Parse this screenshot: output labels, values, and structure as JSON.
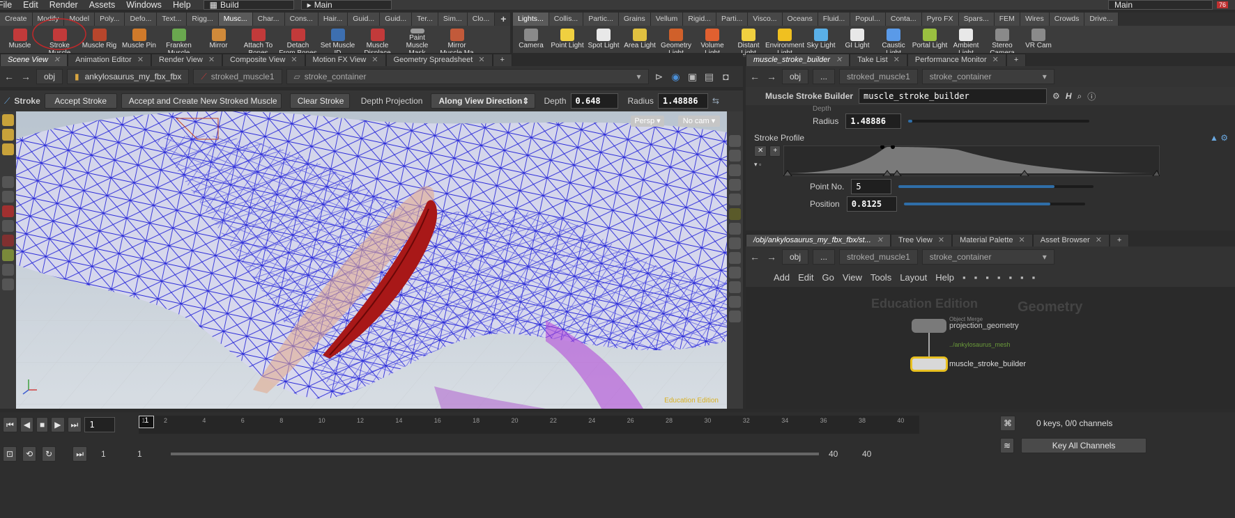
{
  "menu": [
    "File",
    "Edit",
    "Render",
    "Assets",
    "Windows",
    "Help"
  ],
  "desktop": {
    "build": "Build",
    "main": "Main"
  },
  "shelf_tabs_left": [
    "Create",
    "Modify",
    "Model",
    "Poly...",
    "Defo...",
    "Text...",
    "Rigg...",
    "Musc...",
    "Char...",
    "Cons...",
    "Hair...",
    "Guid...",
    "Guid...",
    "Ter...",
    "Sim...",
    "Clo..."
  ],
  "shelf_tabs_right": [
    "Lights...",
    "Collis...",
    "Partic...",
    "Grains",
    "Vellum",
    "Rigid...",
    "Parti...",
    "Visco...",
    "Oceans",
    "Fluid...",
    "Popul...",
    "Conta...",
    "Pyro FX",
    "Spars...",
    "FEM",
    "Wires",
    "Crowds",
    "Drive..."
  ],
  "tools_left": [
    {
      "label": "Muscle",
      "color": "#c23a3a"
    },
    {
      "label": "Stroke Muscle",
      "color": "#c23a3a"
    },
    {
      "label": "Muscle Rig",
      "color": "#b8462c"
    },
    {
      "label": "Muscle Pin",
      "color": "#d07a2a"
    },
    {
      "label": "Franken Muscle",
      "color": "#6aa84f"
    },
    {
      "label": "Mirror",
      "color": "#d08a3a"
    },
    {
      "label": "Attach To Bones",
      "color": "#c23a3a"
    },
    {
      "label": "Detach From Bones",
      "color": "#c23a3a"
    },
    {
      "label": "Set Muscle ID",
      "color": "#3d6fb0"
    },
    {
      "label": "Muscle Displace",
      "color": "#c23a3a"
    },
    {
      "label": "Paint Muscle Mask",
      "color": "#9a9a9a"
    },
    {
      "label": "Mirror Muscle Ma",
      "color": "#c25a3a"
    }
  ],
  "tools_right": [
    {
      "label": "Camera",
      "color": "#8a8a8a"
    },
    {
      "label": "Point Light",
      "color": "#f0d040"
    },
    {
      "label": "Spot Light",
      "color": "#e8e8e8"
    },
    {
      "label": "Area Light",
      "color": "#e0c040"
    },
    {
      "label": "Geometry Light",
      "color": "#d0602a"
    },
    {
      "label": "Volume Light",
      "color": "#e06030"
    },
    {
      "label": "Distant Light",
      "color": "#f0d040"
    },
    {
      "label": "Environment Light",
      "color": "#f0c020"
    },
    {
      "label": "Sky Light",
      "color": "#5ab0e8"
    },
    {
      "label": "GI Light",
      "color": "#e8e8e8"
    },
    {
      "label": "Caustic Light",
      "color": "#5a9ae8"
    },
    {
      "label": "Portal Light",
      "color": "#9ac040"
    },
    {
      "label": "Ambient Light",
      "color": "#e8e8e8"
    },
    {
      "label": "Stereo Camera",
      "color": "#8a8a8a"
    },
    {
      "label": "VR Cam",
      "color": "#8a8a8a"
    }
  ],
  "left_pane_tabs": [
    "Scene View",
    "Animation Editor",
    "Render View",
    "Composite View",
    "Motion FX View",
    "Geometry Spreadsheet"
  ],
  "left_path": {
    "root": "obj",
    "c1": "ankylosaurus_my_fbx_fbx",
    "c2": "stroked_muscle1",
    "c3": "stroke_container"
  },
  "stroke_toolbar": {
    "name": "Stroke",
    "accept": "Accept Stroke",
    "accept_create": "Accept and Create New Stroked Muscle",
    "clear": "Clear Stroke",
    "depth_projection_label": "Depth Projection",
    "depth_projection_value": "Along View Direction",
    "depth_label": "Depth",
    "depth_value": "0.648",
    "radius_label": "Radius",
    "radius_value": "1.48886"
  },
  "viewport": {
    "persp": "Persp",
    "cam": "No cam",
    "watermark": "Education Edition"
  },
  "right_top_tabs": [
    "muscle_stroke_builder",
    "Take List",
    "Performance Monitor"
  ],
  "right_path": {
    "root": "obj",
    "dots": "...",
    "c1": "stroked_muscle1",
    "c2": "stroke_container"
  },
  "params": {
    "node_type": "Muscle Stroke Builder",
    "node_name": "muscle_stroke_builder",
    "depth_label": "Depth",
    "radius_label": "Radius",
    "radius_value": "1.48886",
    "radius_fill": 0.02,
    "stroke_profile_label": "Stroke Profile",
    "point_no_label": "Point No.",
    "point_no_value": "5",
    "point_no_fill": 0.8,
    "position_label": "Position",
    "position_value": "0.8125",
    "position_fill": 0.81
  },
  "network_tabs": [
    "/obj/ankylosaurus_my_fbx_fbx/st...",
    "Tree View",
    "Material Palette",
    "Asset Browser"
  ],
  "network_menu": [
    "Add",
    "Edit",
    "Go",
    "View",
    "Tools",
    "Layout",
    "Help"
  ],
  "network": {
    "watermark_edu": "Education Edition",
    "watermark_ctx": "Geometry",
    "node1_type": "Object Merge",
    "node1_name": "projection_geometry",
    "node1_path": "../ankylosaurus_mesh",
    "node2_name": "muscle_stroke_builder"
  },
  "timeline": {
    "frame": "1",
    "ticks": [
      "1",
      "2",
      "4",
      "6",
      "8",
      "10",
      "12",
      "14",
      "16",
      "18",
      "20",
      "22",
      "24",
      "26",
      "28",
      "30",
      "32",
      "34",
      "36",
      "38",
      "40"
    ],
    "start": "1",
    "start2": "1",
    "end": "40",
    "end2": "40",
    "keys": "0 keys, 0/0 channels",
    "key_all": "Key All Channels"
  }
}
